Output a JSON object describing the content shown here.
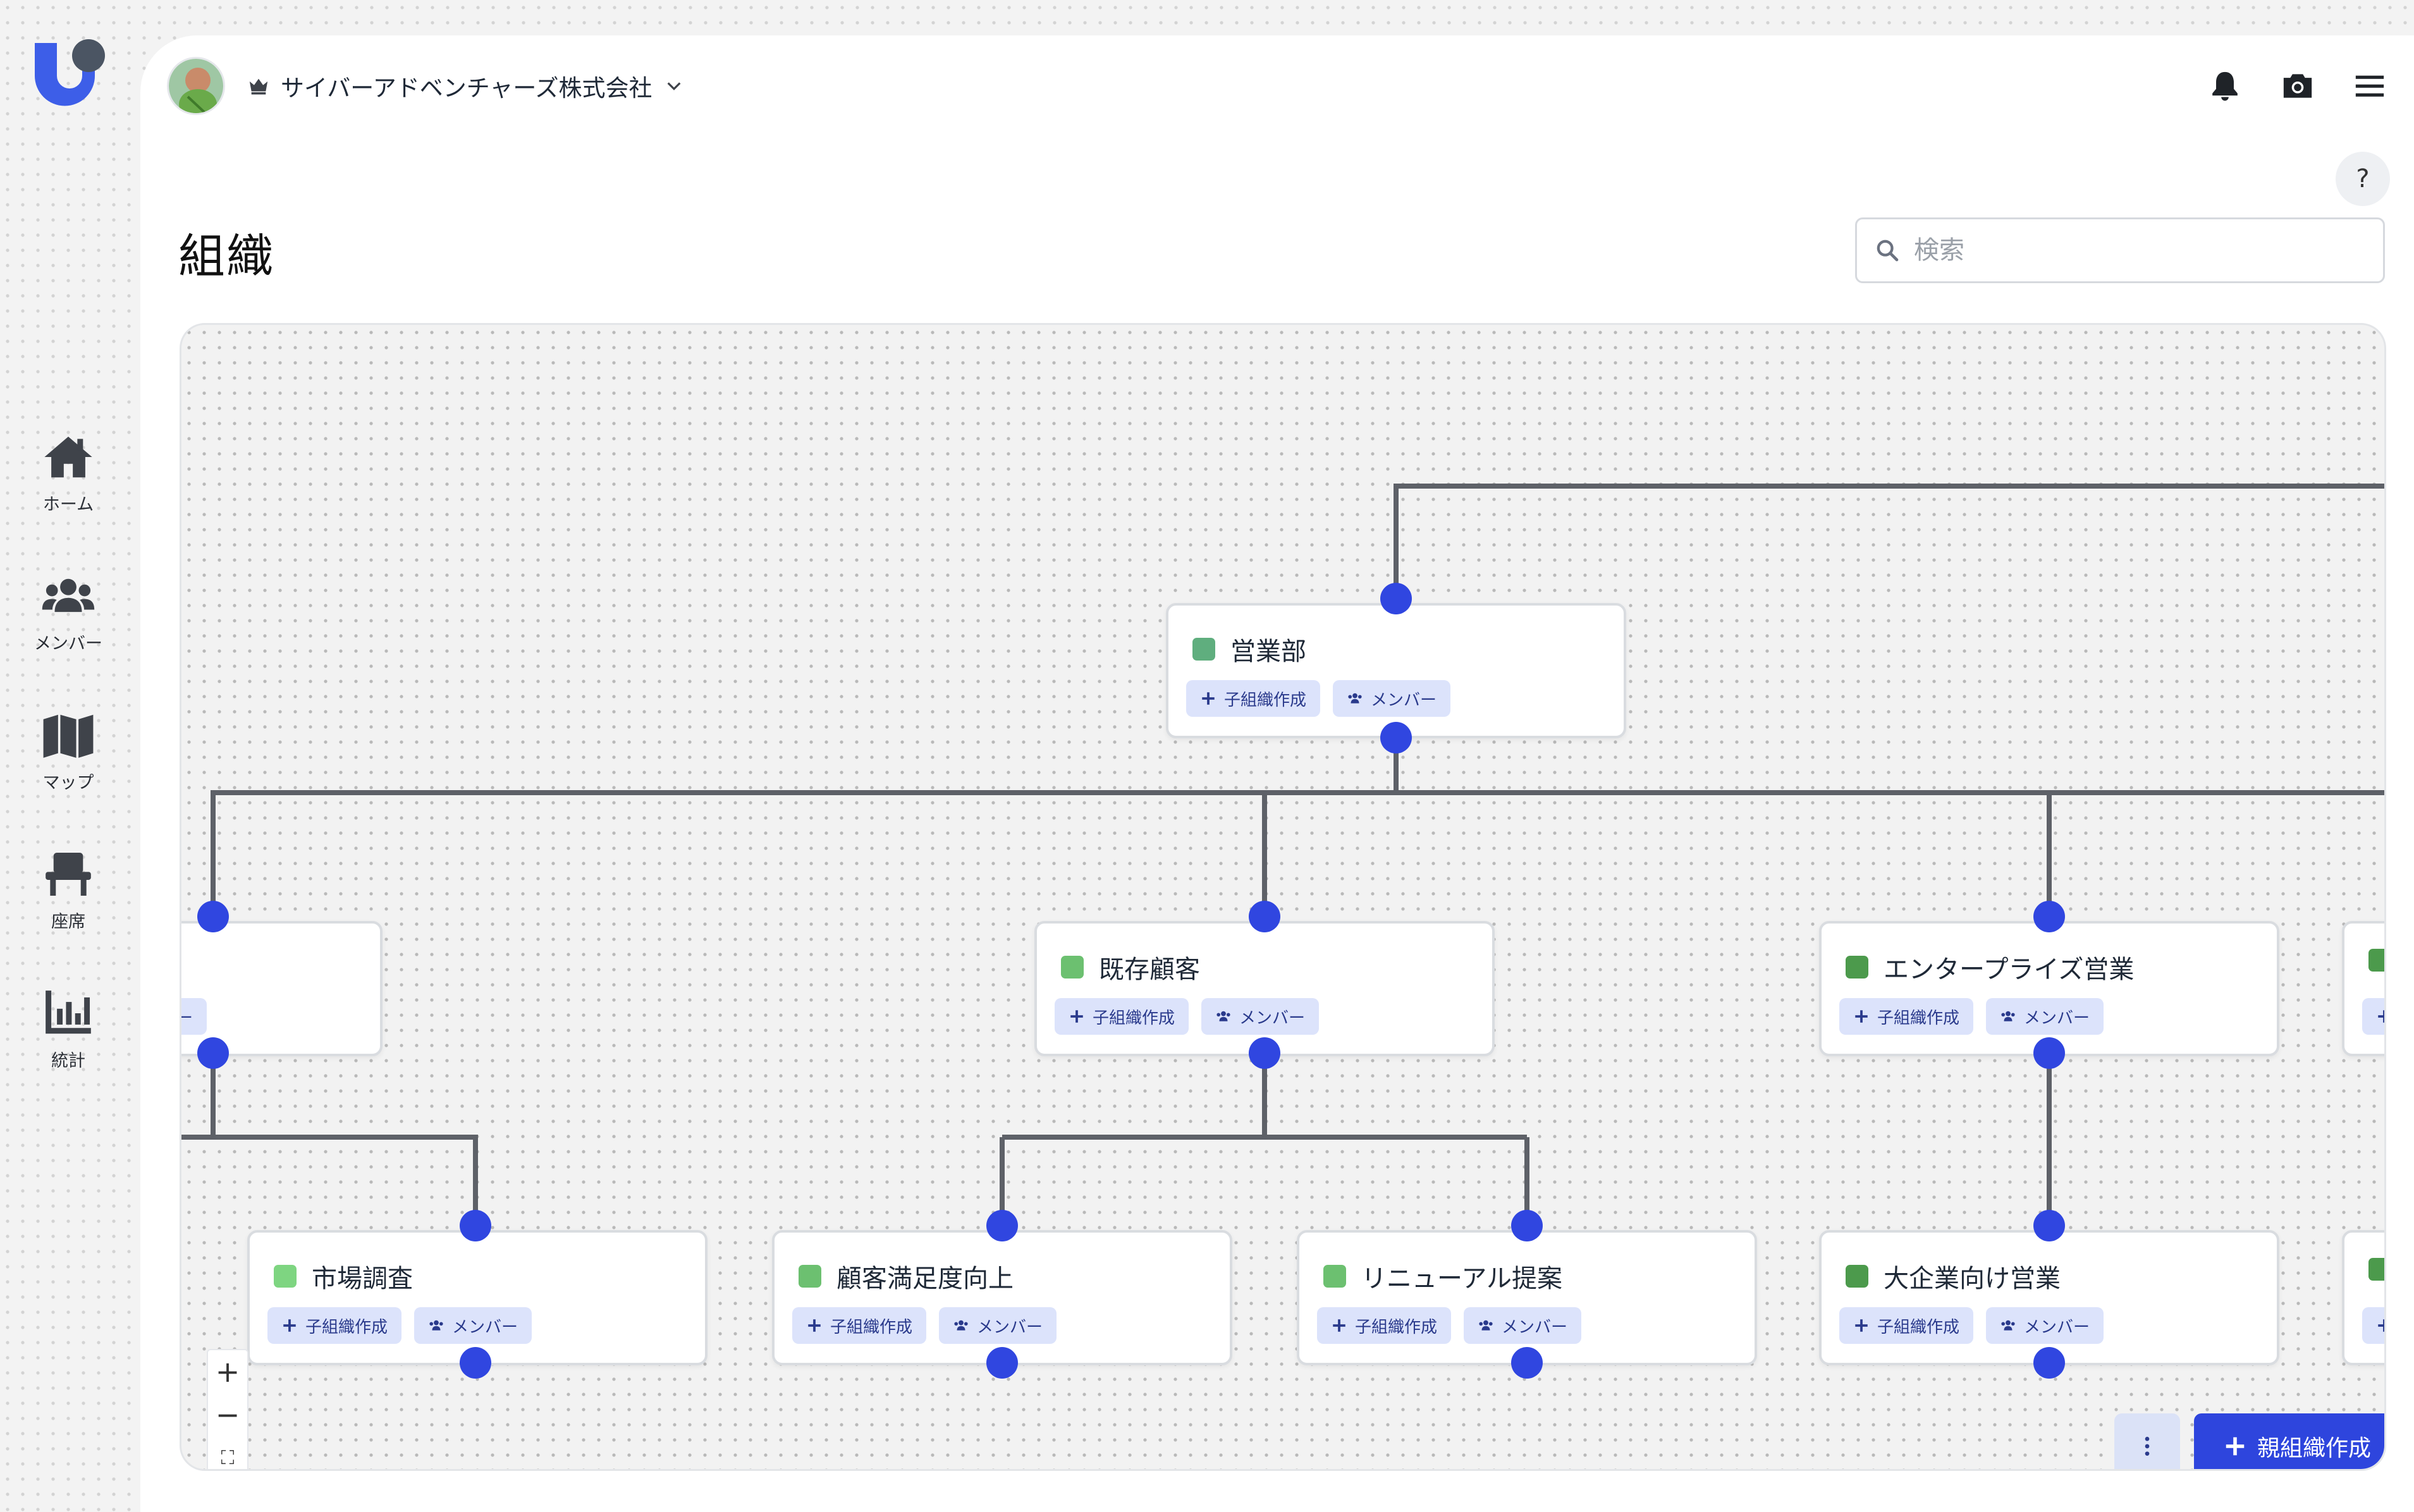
{
  "app": {
    "logo": "app-logo"
  },
  "sidebar": {
    "items": [
      {
        "label": "ホーム",
        "icon": "home-icon"
      },
      {
        "label": "メンバー",
        "icon": "users-icon"
      },
      {
        "label": "マップ",
        "icon": "map-icon"
      },
      {
        "label": "座席",
        "icon": "seat-icon"
      },
      {
        "label": "統計",
        "icon": "chart-icon"
      }
    ]
  },
  "header": {
    "org_name": "サイバーアドベンチャーズ株式会社",
    "icons": [
      "crown-icon",
      "chevron-down-icon",
      "bell-icon",
      "camera-icon",
      "menu-icon"
    ],
    "help_label": "?"
  },
  "page": {
    "title": "組織",
    "search_placeholder": "検索",
    "search_value": ""
  },
  "labels": {
    "add_child": "子組織作成",
    "members": "メンバー",
    "create_parent": "親組織作成",
    "zoom_in": "+",
    "zoom_out": "−",
    "fit": "⛶"
  },
  "org_nodes": [
    {
      "id": "sales",
      "name": "営業部",
      "color": "#5fae7e"
    },
    {
      "id": "left",
      "name": "",
      "color": "#6cc070"
    },
    {
      "id": "existing",
      "name": "既存顧客",
      "color": "#6cc070"
    },
    {
      "id": "enterprise",
      "name": "エンタープライズ営業",
      "color": "#4c9a4c"
    },
    {
      "id": "right",
      "name": "",
      "color": "#4c9a4c"
    },
    {
      "id": "research",
      "name": "市場調査",
      "color": "#7ed581"
    },
    {
      "id": "satisfaction",
      "name": "顧客満足度向上",
      "color": "#6cc070"
    },
    {
      "id": "renewal",
      "name": "リニューアル提案",
      "color": "#6cc070"
    },
    {
      "id": "large",
      "name": "大企業向け営業",
      "color": "#4c9a4c"
    },
    {
      "id": "right2",
      "name": "",
      "color": "#4c9a4c"
    }
  ],
  "colors": {
    "accent": "#3046e0",
    "chip_bg": "#dce3fb",
    "edge": "#5e6168"
  }
}
